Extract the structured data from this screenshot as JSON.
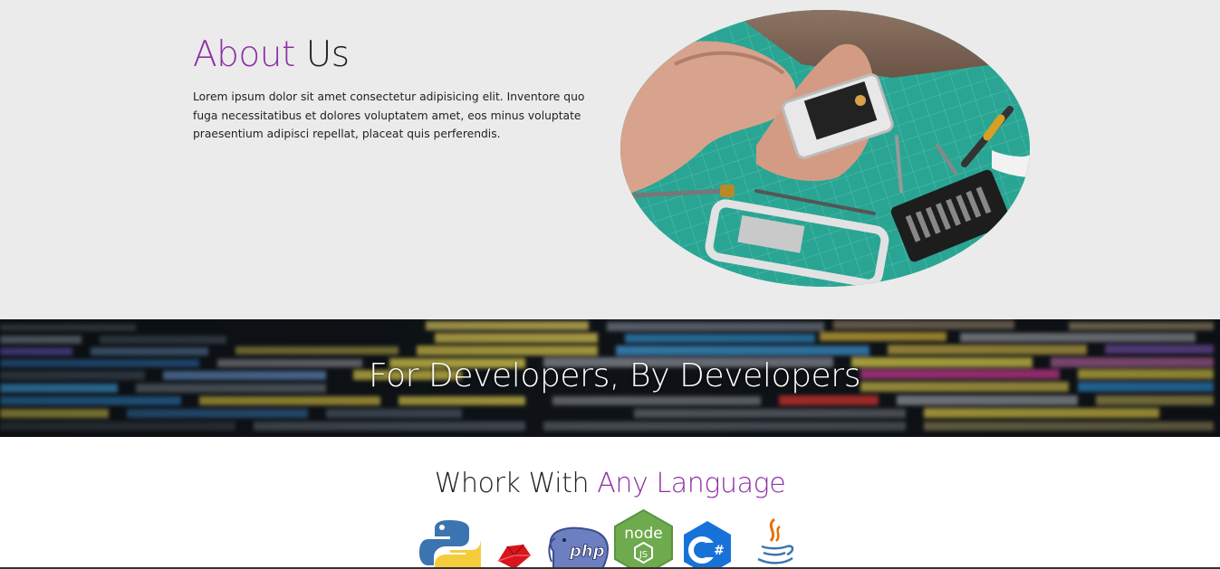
{
  "about": {
    "title_accent": "About",
    "title_rest": " Us",
    "text": "Lorem ipsum dolor sit amet consectetur adipisicing elit. Inventore quo fuga necessitatibus et dolores voluptatem amet, eos minus voluptate praesentium adipisci repellat, placeat quis perferendis.",
    "image_icon": "phone-repair-photo"
  },
  "banner": {
    "title": "For Developers, By Developers",
    "background_icon": "code-screen-photo"
  },
  "languages": {
    "title_plain": "Whork With ",
    "title_accent": "Any Language",
    "logos": [
      "python-icon",
      "ruby-icon",
      "php-icon",
      "nodejs-icon",
      "csharp-icon",
      "java-icon"
    ],
    "php_label": "php",
    "node_label": "node",
    "node_js": "JS",
    "csharp_label": "C#"
  },
  "colors": {
    "accent": "#8e2fa6",
    "about_bg": "#ebebeb",
    "text": "#222222"
  }
}
